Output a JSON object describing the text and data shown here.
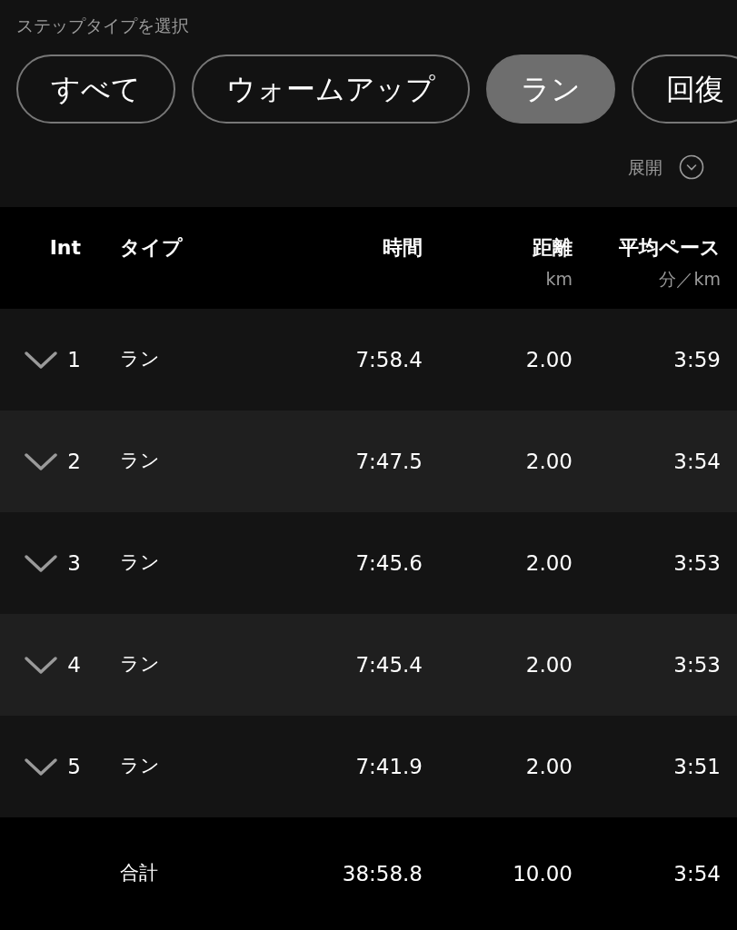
{
  "section_label": "ステップタイプを選択",
  "chips": [
    {
      "label": "すべて",
      "selected": false
    },
    {
      "label": "ウォームアップ",
      "selected": false
    },
    {
      "label": "ラン",
      "selected": true
    },
    {
      "label": "回復",
      "selected": false
    }
  ],
  "expand": {
    "label": "展開"
  },
  "table": {
    "columns": [
      {
        "label": "Int"
      },
      {
        "label": "タイプ"
      },
      {
        "label": "時間"
      },
      {
        "label": "距離",
        "unit": "km"
      },
      {
        "label": "平均ペース",
        "unit": "分／km"
      }
    ],
    "rows": [
      {
        "int": "1",
        "type": "ラン",
        "time": "7:58.4",
        "distance": "2.00",
        "pace": "3:59"
      },
      {
        "int": "2",
        "type": "ラン",
        "time": "7:47.5",
        "distance": "2.00",
        "pace": "3:54"
      },
      {
        "int": "3",
        "type": "ラン",
        "time": "7:45.6",
        "distance": "2.00",
        "pace": "3:53"
      },
      {
        "int": "4",
        "type": "ラン",
        "time": "7:45.4",
        "distance": "2.00",
        "pace": "3:53"
      },
      {
        "int": "5",
        "type": "ラン",
        "time": "7:41.9",
        "distance": "2.00",
        "pace": "3:51"
      }
    ],
    "total": {
      "label": "合計",
      "time": "38:58.8",
      "distance": "10.00",
      "pace": "3:54"
    }
  }
}
